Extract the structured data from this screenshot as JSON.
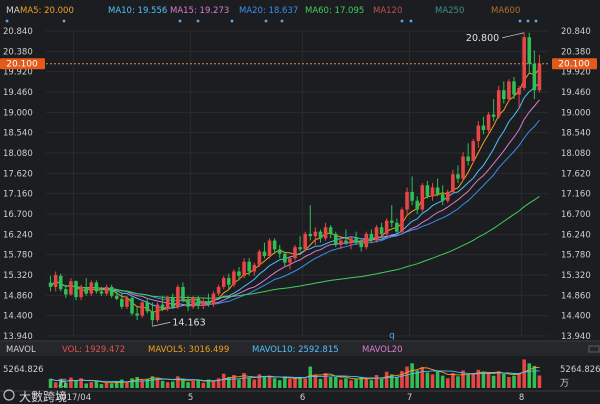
{
  "header": {
    "chart_label": "MA",
    "ma_items": [
      {
        "name": "MA5",
        "value": "20.000",
        "color": "#f0a020"
      },
      {
        "name": "MA10",
        "value": "19.556",
        "color": "#4fc1ff"
      },
      {
        "name": "MA15",
        "value": "19.273",
        "color": "#d97bd2"
      },
      {
        "name": "MA20",
        "value": "18.637",
        "color": "#3a8ef0"
      },
      {
        "name": "MA60",
        "value": "17.095",
        "color": "#3ecf5a"
      },
      {
        "name": "MA120",
        "value": "",
        "color": "#c05050"
      },
      {
        "name": "MA250",
        "value": "",
        "color": "#3f8f8f"
      },
      {
        "name": "MA600",
        "value": "",
        "color": "#b07030"
      }
    ]
  },
  "price_axis": {
    "ticks": [
      20.84,
      20.38,
      19.92,
      19.46,
      19.0,
      18.54,
      18.08,
      17.62,
      17.16,
      16.7,
      16.24,
      15.78,
      15.32,
      14.86,
      14.4,
      13.94
    ],
    "tick_labels": [
      "20.840",
      "20.380",
      "19.920",
      "19.460",
      "19.000",
      "18.540",
      "18.080",
      "17.620",
      "17.160",
      "16.700",
      "16.240",
      "15.780",
      "15.320",
      "14.860",
      "14.400",
      "13.940"
    ],
    "current_price": 20.1,
    "current_label": "20.100",
    "high_label": "20.800",
    "low_label": "14.163"
  },
  "volume_panel": {
    "title": "MAVOL",
    "items": [
      {
        "name": "VOL",
        "value": "1929.472",
        "color": "#e05050"
      },
      {
        "name": "MAVOL5",
        "value": "3016.499",
        "color": "#f0a020"
      },
      {
        "name": "MAVOL10",
        "value": "2592.815",
        "color": "#4fc1ff"
      },
      {
        "name": "MAVOL20",
        "value": "",
        "color": "#d97bd2"
      }
    ],
    "axis_value": "5264.826",
    "unit": "万"
  },
  "x_axis": {
    "labels": [
      "2017/04",
      "5",
      "6",
      "7",
      "8"
    ]
  },
  "watermark": "大數跨境",
  "chart_data": {
    "type": "candlestick",
    "ylim": [
      13.94,
      20.84
    ],
    "month_start_index": {
      "2017/04": 5,
      "5": 28,
      "6": 50,
      "7": 71,
      "8": 93
    },
    "ohlc": [
      [
        15.15,
        15.3,
        14.95,
        15.05
      ],
      [
        15.05,
        15.4,
        14.95,
        15.32
      ],
      [
        15.3,
        15.35,
        14.95,
        15.0
      ],
      [
        15.0,
        15.1,
        14.8,
        14.88
      ],
      [
        14.88,
        15.25,
        14.85,
        15.18
      ],
      [
        15.18,
        15.2,
        14.75,
        14.82
      ],
      [
        14.82,
        15.1,
        14.75,
        15.05
      ],
      [
        15.05,
        15.25,
        14.85,
        14.9
      ],
      [
        14.9,
        15.2,
        14.85,
        15.15
      ],
      [
        15.15,
        15.2,
        14.9,
        14.95
      ],
      [
        14.95,
        15.05,
        14.85,
        14.9
      ],
      [
        14.9,
        15.1,
        14.85,
        15.05
      ],
      [
        15.05,
        15.1,
        14.8,
        14.85
      ],
      [
        14.85,
        15.0,
        14.75,
        14.78
      ],
      [
        14.78,
        14.9,
        14.55,
        14.6
      ],
      [
        14.6,
        14.85,
        14.55,
        14.8
      ],
      [
        14.8,
        14.85,
        14.4,
        14.45
      ],
      [
        14.45,
        14.6,
        14.3,
        14.4
      ],
      [
        14.4,
        14.75,
        14.35,
        14.7
      ],
      [
        14.7,
        14.8,
        14.45,
        14.5
      ],
      [
        14.5,
        14.7,
        14.16,
        14.3
      ],
      [
        14.3,
        14.7,
        14.25,
        14.65
      ],
      [
        14.65,
        14.85,
        14.5,
        14.55
      ],
      [
        14.55,
        14.85,
        14.5,
        14.8
      ],
      [
        14.8,
        14.9,
        14.55,
        14.6
      ],
      [
        14.6,
        15.1,
        14.55,
        15.05
      ],
      [
        15.05,
        15.15,
        14.7,
        14.75
      ],
      [
        14.75,
        14.85,
        14.5,
        14.6
      ],
      [
        14.6,
        14.85,
        14.55,
        14.8
      ],
      [
        14.8,
        14.85,
        14.55,
        14.62
      ],
      [
        14.62,
        14.8,
        14.55,
        14.72
      ],
      [
        14.72,
        14.9,
        14.6,
        14.65
      ],
      [
        14.65,
        14.95,
        14.6,
        14.9
      ],
      [
        14.9,
        15.1,
        14.85,
        15.05
      ],
      [
        15.05,
        15.3,
        15.0,
        15.25
      ],
      [
        15.25,
        15.35,
        15.0,
        15.1
      ],
      [
        15.1,
        15.45,
        15.05,
        15.4
      ],
      [
        15.4,
        15.5,
        15.2,
        15.3
      ],
      [
        15.3,
        15.7,
        15.25,
        15.62
      ],
      [
        15.62,
        15.7,
        15.3,
        15.4
      ],
      [
        15.4,
        15.6,
        15.3,
        15.55
      ],
      [
        15.55,
        15.9,
        15.5,
        15.85
      ],
      [
        15.85,
        16.05,
        15.7,
        15.75
      ],
      [
        15.75,
        16.15,
        15.7,
        16.1
      ],
      [
        16.1,
        16.15,
        15.8,
        15.9
      ],
      [
        15.9,
        16.0,
        15.7,
        15.8
      ],
      [
        15.8,
        15.85,
        15.5,
        15.6
      ],
      [
        15.6,
        15.75,
        15.45,
        15.7
      ],
      [
        15.7,
        16.0,
        15.65,
        15.95
      ],
      [
        15.95,
        16.2,
        15.85,
        15.9
      ],
      [
        15.9,
        16.3,
        15.85,
        16.25
      ],
      [
        16.25,
        16.9,
        16.1,
        16.2
      ],
      [
        16.2,
        16.4,
        16.0,
        16.3
      ],
      [
        16.3,
        16.35,
        16.05,
        16.15
      ],
      [
        16.15,
        16.5,
        16.1,
        16.4
      ],
      [
        16.4,
        16.45,
        16.15,
        16.25
      ],
      [
        16.25,
        16.3,
        15.95,
        16.0
      ],
      [
        16.0,
        16.2,
        15.9,
        16.1
      ],
      [
        16.1,
        16.35,
        16.0,
        16.05
      ],
      [
        16.05,
        16.2,
        15.9,
        16.15
      ],
      [
        16.15,
        16.3,
        16.0,
        16.05
      ],
      [
        16.05,
        16.15,
        15.85,
        15.95
      ],
      [
        15.95,
        16.3,
        15.9,
        16.25
      ],
      [
        16.25,
        16.35,
        16.05,
        16.1
      ],
      [
        16.1,
        16.45,
        16.05,
        16.4
      ],
      [
        16.4,
        16.5,
        16.2,
        16.25
      ],
      [
        16.25,
        16.6,
        16.2,
        16.55
      ],
      [
        16.55,
        16.9,
        16.4,
        16.5
      ],
      [
        16.5,
        16.6,
        16.25,
        16.3
      ],
      [
        16.3,
        16.85,
        16.25,
        16.8
      ],
      [
        16.8,
        17.3,
        16.7,
        17.2
      ],
      [
        17.2,
        17.55,
        16.9,
        17.0
      ],
      [
        17.0,
        17.1,
        16.7,
        16.8
      ],
      [
        16.8,
        17.4,
        16.75,
        17.35
      ],
      [
        17.35,
        17.45,
        17.05,
        17.1
      ],
      [
        17.1,
        17.4,
        17.0,
        17.3
      ],
      [
        17.3,
        17.5,
        17.1,
        17.15
      ],
      [
        17.15,
        17.35,
        16.9,
        17.0
      ],
      [
        17.0,
        17.25,
        16.95,
        17.2
      ],
      [
        17.2,
        17.7,
        17.15,
        17.6
      ],
      [
        17.6,
        17.8,
        17.4,
        17.5
      ],
      [
        17.5,
        18.1,
        17.45,
        18.0
      ],
      [
        18.0,
        18.3,
        17.8,
        17.9
      ],
      [
        17.9,
        18.4,
        17.85,
        18.35
      ],
      [
        18.35,
        18.8,
        18.2,
        18.7
      ],
      [
        18.7,
        18.9,
        18.5,
        18.6
      ],
      [
        18.6,
        19.0,
        18.55,
        18.95
      ],
      [
        18.95,
        19.3,
        18.8,
        18.9
      ],
      [
        18.9,
        19.6,
        18.85,
        19.5
      ],
      [
        19.5,
        19.7,
        19.2,
        19.3
      ],
      [
        19.3,
        19.75,
        19.25,
        19.7
      ],
      [
        19.7,
        19.8,
        19.3,
        19.4
      ],
      [
        19.4,
        19.6,
        19.1,
        19.55
      ],
      [
        19.55,
        20.8,
        19.5,
        20.7
      ],
      [
        20.7,
        20.8,
        19.9,
        20.1
      ],
      [
        20.1,
        20.4,
        19.3,
        19.5
      ],
      [
        19.5,
        20.3,
        19.45,
        20.1
      ]
    ],
    "volume": [
      1400,
      900,
      1100,
      800,
      1600,
      1200,
      1500,
      700,
      900,
      1100,
      600,
      800,
      700,
      900,
      1300,
      1000,
      1500,
      1700,
      1200,
      1400,
      1800,
      1600,
      1100,
      900,
      1000,
      1800,
      1300,
      900,
      1100,
      1200,
      800,
      1300,
      1000,
      1500,
      2200,
      1700,
      2000,
      1300,
      2300,
      1600,
      1300,
      2100,
      1700,
      1900,
      1500,
      1200,
      1800,
      1400,
      1600,
      1700,
      1500,
      3300,
      2000,
      1400,
      2300,
      1700,
      1700,
      1300,
      1500,
      1200,
      1400,
      1700,
      1500,
      1200,
      2000,
      1400,
      2500,
      2100,
      1700,
      2600,
      3300,
      3800,
      2700,
      3200,
      2400,
      2100,
      2600,
      1900,
      1500,
      2300,
      1800,
      2700,
      2000,
      2300,
      2800,
      2500,
      2400,
      1900,
      2600,
      2200,
      1700,
      1900,
      2200,
      4400,
      3800,
      3400,
      1929
    ]
  }
}
